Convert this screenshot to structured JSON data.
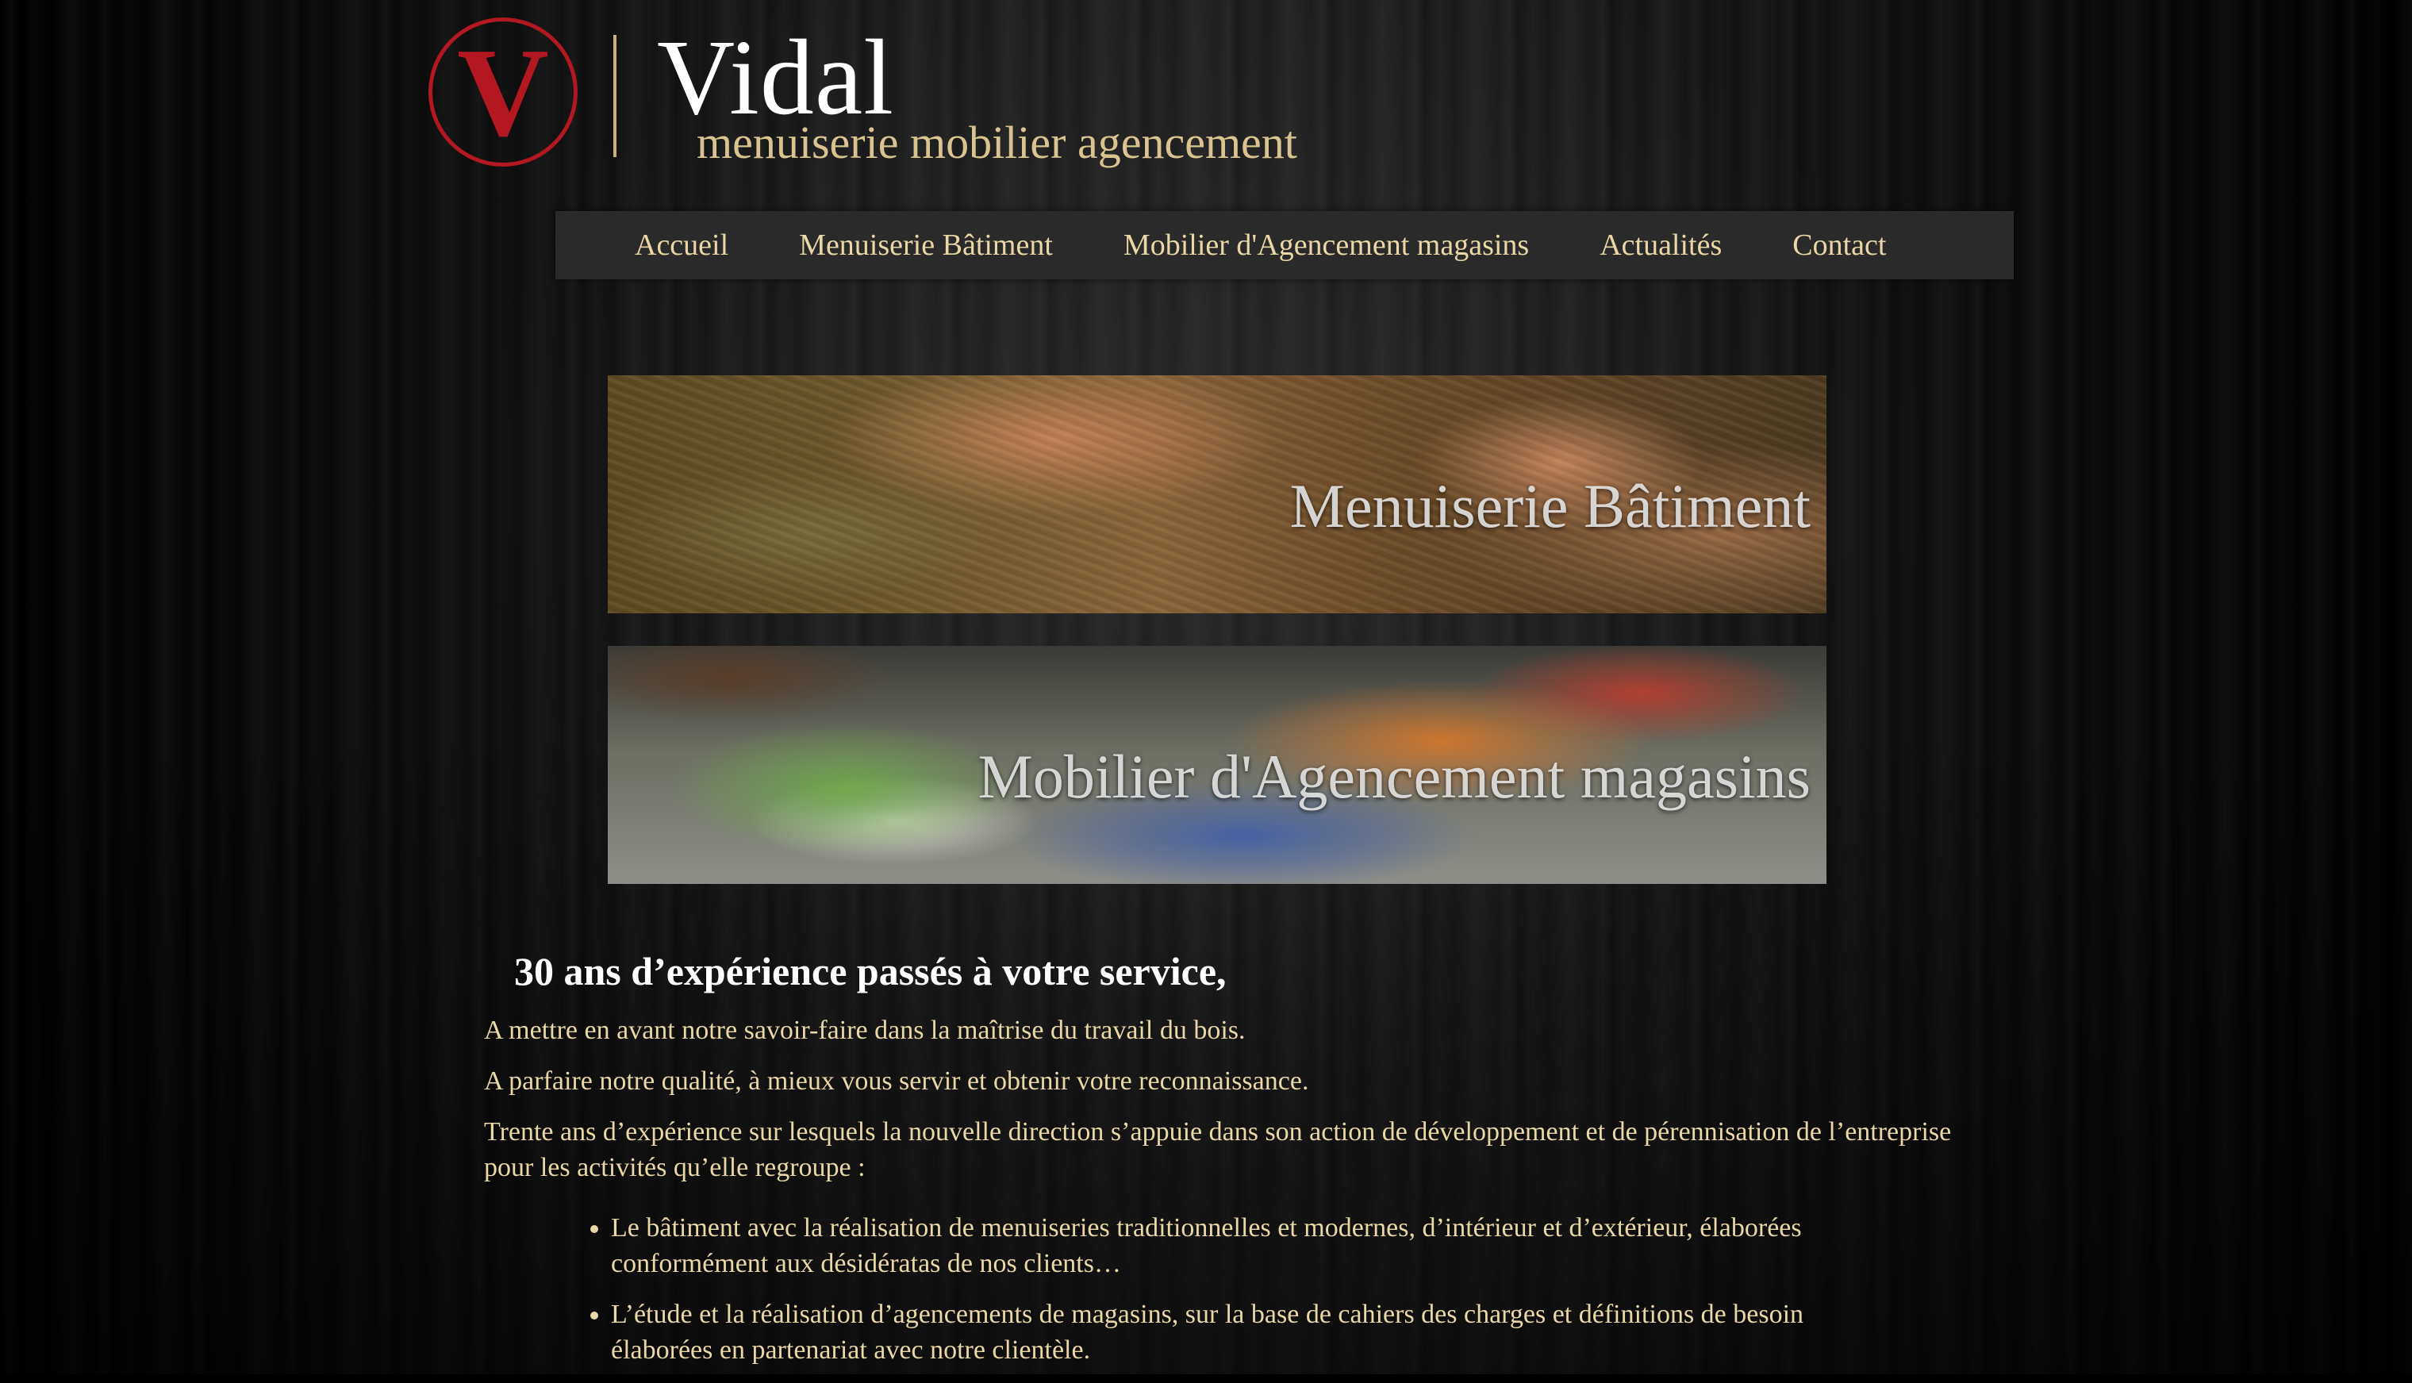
{
  "header": {
    "logo_letter": "V",
    "brand_name": "Vidal",
    "tagline": "menuiserie mobilier agencement"
  },
  "nav": {
    "items": [
      {
        "label": "Accueil"
      },
      {
        "label": "Menuiserie Bâtiment"
      },
      {
        "label": "Mobilier d'Agencement magasins"
      },
      {
        "label": "Actualités"
      },
      {
        "label": "Contact"
      }
    ]
  },
  "banners": [
    {
      "label": "Menuiserie Bâtiment"
    },
    {
      "label": "Mobilier d'Agencement magasins"
    }
  ],
  "content": {
    "title": "30 ans d’expérience passés à votre service,",
    "paragraphs": [
      "A mettre en avant notre savoir-faire dans la maîtrise du travail du bois.",
      "A parfaire notre qualité, à mieux vous servir et obtenir votre reconnaissance.",
      "Trente ans d’expérience sur lesquels la nouvelle direction s’appuie dans son action de développement et de pérennisation de l’entreprise pour les activités qu’elle regroupe :"
    ],
    "bullets": [
      "Le bâtiment avec la réalisation de menuiseries traditionnelles et modernes, d’intérieur et d’extérieur, élaborées conformément aux désidératas de nos clients…",
      "L’étude et la réalisation d’agencements de magasins, sur la base de cahiers des charges et définitions de besoin élaborées en partenariat avec notre clientèle."
    ]
  },
  "colors": {
    "logo_red": "#b3171f",
    "nav_text": "#e9d7a6",
    "tagline": "#d9c490",
    "nav_bg": "#2a2a2a"
  }
}
